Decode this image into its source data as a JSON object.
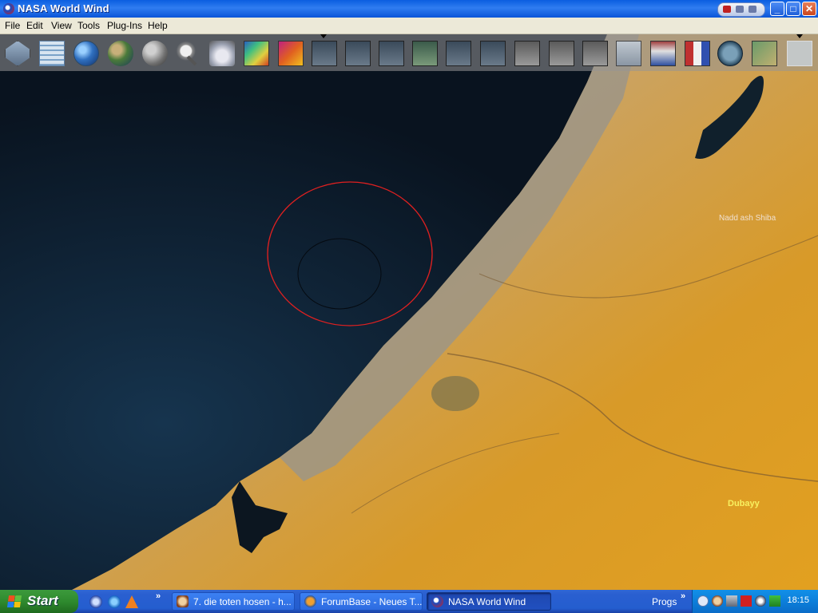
{
  "window": {
    "title": "NASA World Wind",
    "controls": [
      "_",
      "□",
      "✕"
    ]
  },
  "menubar": {
    "items": [
      "File",
      "Edit",
      "View",
      "Tools",
      "Plug-Ins",
      "Help"
    ]
  },
  "toolbar": {
    "buttons": [
      {
        "name": "layer-manager-button",
        "icon": "layers-icon",
        "label": ""
      },
      {
        "name": "lat-lon-grid-button",
        "icon": "grid-icon",
        "label": ""
      },
      {
        "name": "world-globe-button",
        "icon": "globe-icon",
        "label": ""
      },
      {
        "name": "earth-button",
        "icon": "earth-icon",
        "label": ""
      },
      {
        "name": "moon-button",
        "icon": "moon-icon",
        "label": ""
      },
      {
        "name": "place-finder-button",
        "icon": "magnifier-icon",
        "label": ""
      },
      {
        "name": "rapid-fire-modis-button",
        "icon": "rapid-fire-icon",
        "label": ""
      },
      {
        "name": "modis-button",
        "icon": "modis-icon",
        "label": ""
      },
      {
        "name": "thermal-button",
        "icon": "thermal-icon",
        "label": ""
      },
      {
        "name": "landsat-visible-button",
        "icon": "landsat-icon",
        "label": ""
      },
      {
        "name": "landsat-pan-button",
        "icon": "landsat-icon",
        "label": ""
      },
      {
        "name": "landsat-pan-2-button",
        "icon": "landsat-icon",
        "label": ""
      },
      {
        "name": "landsat-visible-2-button",
        "icon": "landsat-icon",
        "label": ""
      },
      {
        "name": "landsat-visible-3-button",
        "icon": "landsat-icon",
        "label": ""
      },
      {
        "name": "landsat-pseudo-button",
        "icon": "landsat-icon",
        "label": ""
      },
      {
        "name": "usgs-ortho-button",
        "icon": "aerial-icon",
        "label": ""
      },
      {
        "name": "usgs-urban-button",
        "icon": "aerial-icon",
        "label": ""
      },
      {
        "name": "usgs-topo-button",
        "icon": "aerial-icon",
        "label": ""
      },
      {
        "name": "usgs-boundaries-button",
        "icon": "usgs-icon",
        "label": ""
      },
      {
        "name": "placenames-button",
        "icon": "places-icon",
        "label": ""
      },
      {
        "name": "flags-button",
        "icon": "flags-icon",
        "label": ""
      },
      {
        "name": "landmarks-button",
        "icon": "landmarks-icon",
        "label": ""
      },
      {
        "name": "place-bar-button",
        "icon": "placefinder-icon",
        "label": ""
      },
      {
        "name": "navigation-button",
        "icon": "nav-icon",
        "label": ""
      }
    ]
  },
  "map": {
    "place_labels": [
      {
        "name": "place-label-nadd-ash-shiba",
        "text": "Nadd ash Shiba"
      },
      {
        "name": "place-label-dubayy",
        "text": "Dubayy"
      }
    ]
  },
  "taskbar": {
    "start_label": "Start",
    "tasks": [
      {
        "label": "7. die toten hosen - h...",
        "active": false
      },
      {
        "label": "ForumBase - Neues T...",
        "active": false
      },
      {
        "label": "NASA World Wind",
        "active": true
      }
    ],
    "progs_label": "Progs",
    "clock": "18:15",
    "chevron": "»"
  },
  "colors": {
    "accent": "#0a5ee0",
    "sea": "#0c1c30",
    "desert": "#d49a2a",
    "circle_outer": "#e02020",
    "label_white": "#f0e0d0",
    "label_yellow": "#f8f060"
  }
}
